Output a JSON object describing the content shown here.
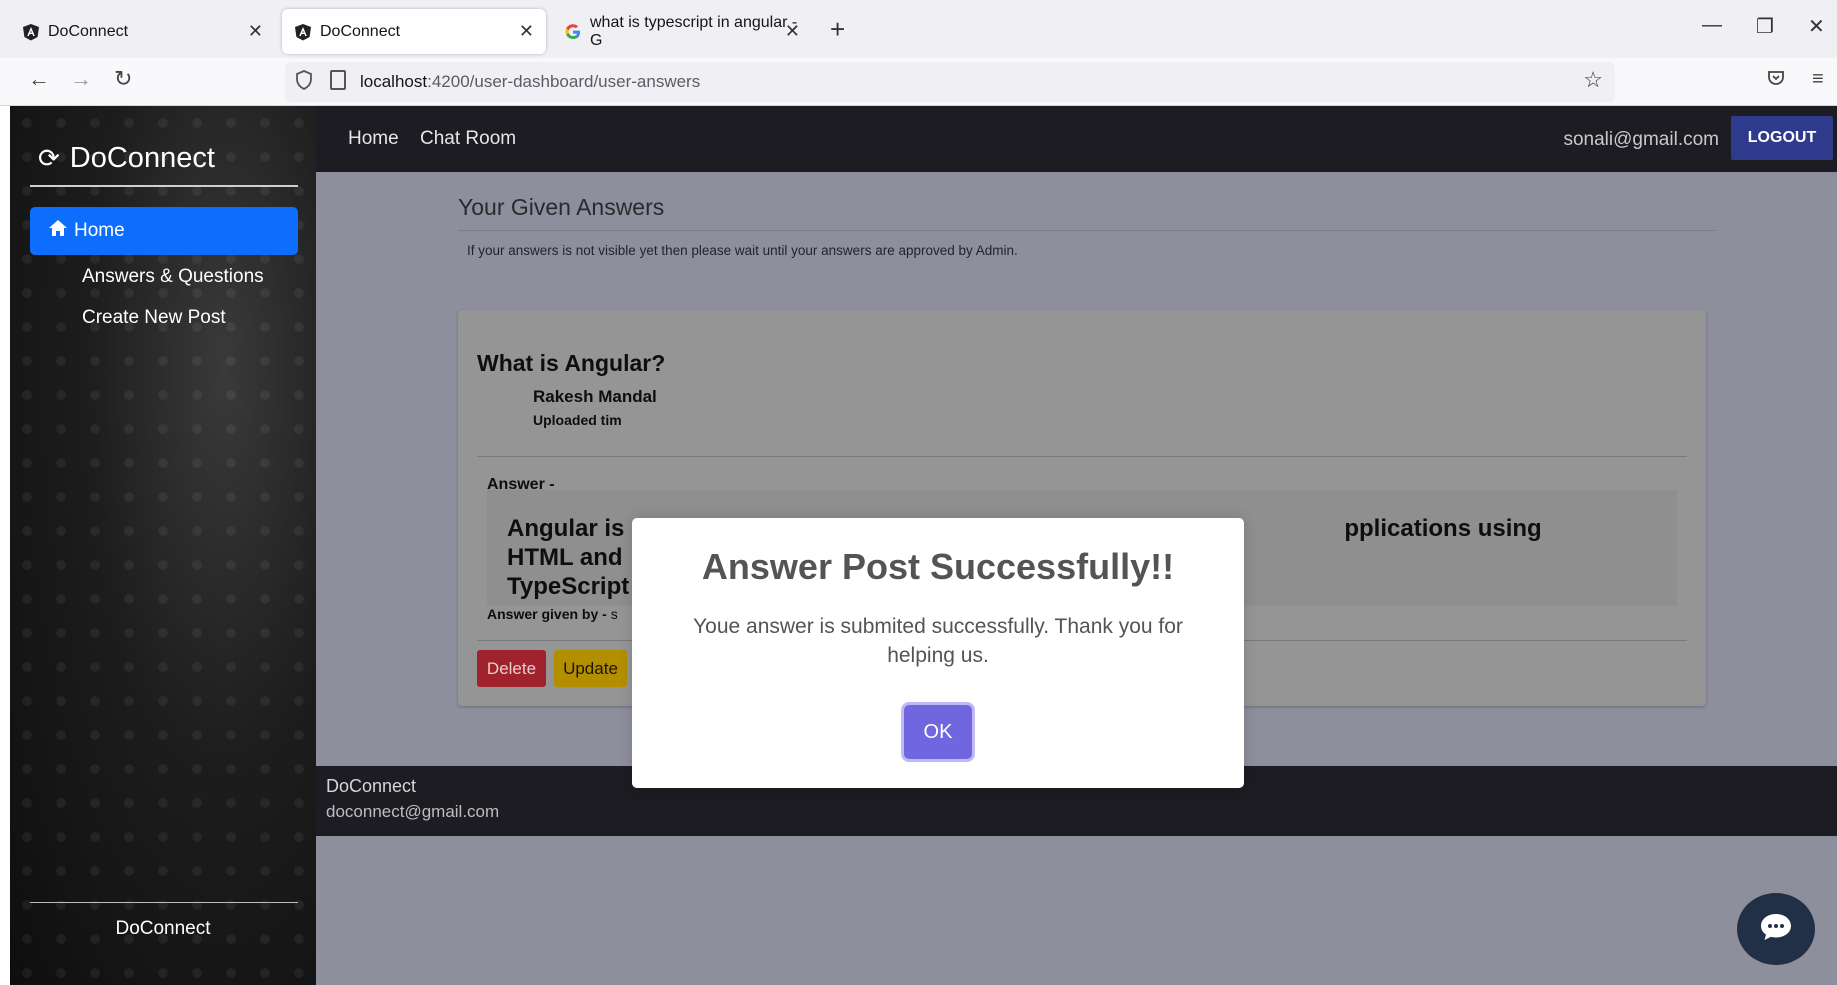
{
  "browser": {
    "tabs": [
      {
        "title": "DoConnect",
        "active": false
      },
      {
        "title": "DoConnect",
        "active": true
      },
      {
        "title": "what is typescript in angular - G",
        "active": false
      }
    ],
    "url_host": "localhost",
    "url_path": ":4200/user-dashboard/user-answers"
  },
  "sidebar": {
    "brand": "DoConnect",
    "items": [
      {
        "label": "Home",
        "active": true
      },
      {
        "label": "Answers & Questions",
        "active": false
      },
      {
        "label": "Create New Post",
        "active": false
      }
    ],
    "footer": "DoConnect"
  },
  "topnav": {
    "links": [
      "Home",
      "Chat Room"
    ],
    "user_email": "sonali@gmail.com",
    "logout_label": "LOGOUT"
  },
  "main": {
    "title": "Your Given Answers",
    "note": "If your answers is not visible yet then please wait until your answers are approved by Admin.",
    "card": {
      "question": "What is Angular?",
      "author": "Rakesh Mandal",
      "uploaded_label": "Uploaded tim",
      "answer_label": "Answer -",
      "answer_text_start": "Angular is",
      "answer_text_end": "pplications using HTML and",
      "answer_text_line2": "TypeScript",
      "answer_by_label": "Answer given by -",
      "answer_by_name": "s",
      "buttons": {
        "delete": "Delete",
        "update": "Update"
      }
    }
  },
  "footer": {
    "name": "DoConnect",
    "email": "doconnect@gmail.com"
  },
  "modal": {
    "title": "Answer Post Successfully!!",
    "message": "Youe answer is submited successfully. Thank you for helping us.",
    "ok_label": "OK"
  },
  "colors": {
    "primary": "#0d6efd",
    "modal_button": "#7066e0",
    "delete": "#dc3545",
    "update": "#ffc107",
    "success": "#198754",
    "dark_nav": "#1c1c22",
    "logout": "#2e3a8c"
  }
}
